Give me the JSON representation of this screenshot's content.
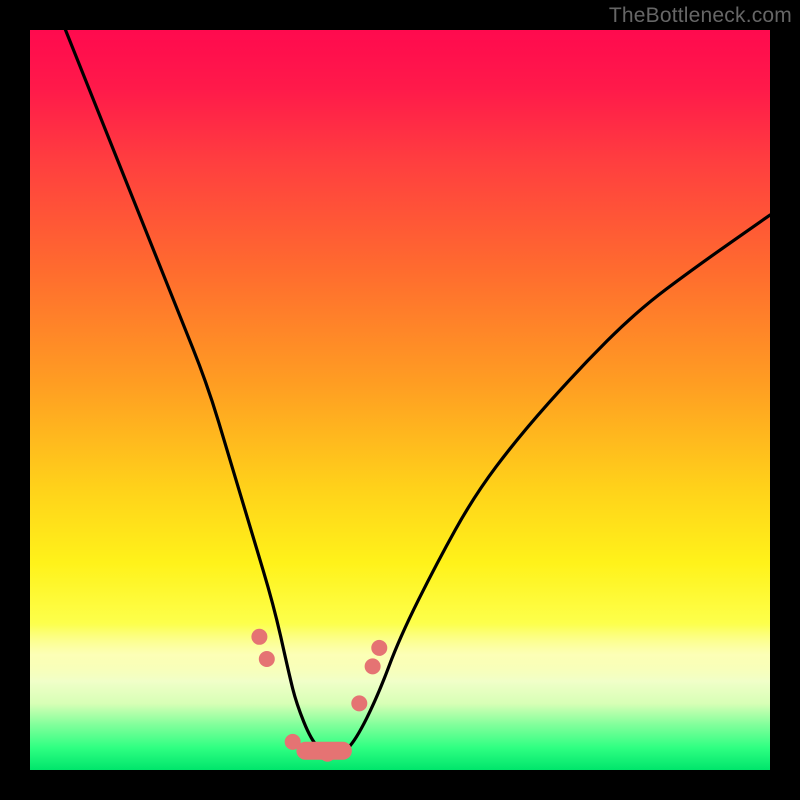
{
  "watermark": "TheBottleneck.com",
  "chart_data": {
    "type": "line",
    "title": "",
    "xlabel": "",
    "ylabel": "",
    "xlim": [
      0,
      100
    ],
    "ylim": [
      0,
      100
    ],
    "grid": false,
    "series": [
      {
        "name": "bottleneck-curve",
        "x": [
          4,
          8,
          12,
          16,
          20,
          24,
          27,
          30,
          33,
          35,
          36,
          38,
          40,
          42,
          44,
          47,
          50,
          55,
          60,
          66,
          74,
          82,
          90,
          100
        ],
        "values": [
          102,
          92,
          82,
          72,
          62,
          52,
          42,
          32,
          22,
          13,
          9,
          4,
          2,
          2,
          4,
          10,
          18,
          28,
          37,
          45,
          54,
          62,
          68,
          75
        ]
      },
      {
        "name": "highlight-pills",
        "x": [
          31,
          32,
          35.5,
          40.2,
          44.5,
          46.3,
          47.2
        ],
        "values": [
          18,
          15,
          3.8,
          2.2,
          9.0,
          14.0,
          16.5
        ]
      }
    ],
    "annotations": [],
    "colors": {
      "curve": "#000000",
      "pill": "#e57373",
      "gradient_top": "#ff0a4e",
      "gradient_bottom": "#00e56b"
    }
  }
}
